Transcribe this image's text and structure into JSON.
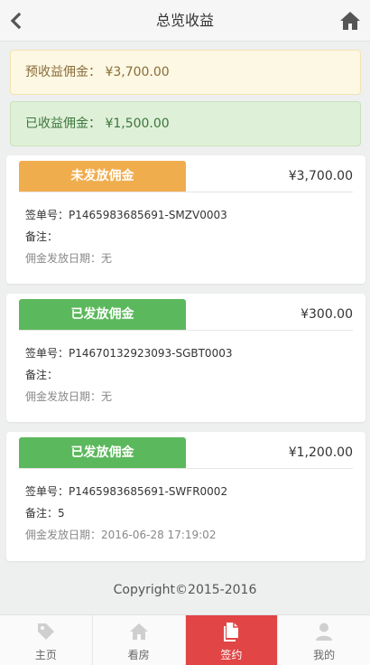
{
  "header": {
    "title": "总览收益"
  },
  "summary": {
    "pending": "预收益佣金： ¥3,700.00",
    "received": "已收益佣金： ¥1,500.00"
  },
  "cards": [
    {
      "status": "未发放佣金",
      "status_color": "#f0ad4e",
      "amount": "¥3,700.00",
      "order": "签单号：P1465983685691-SMZV0003",
      "note": "备注：",
      "date": "佣金发放日期：无"
    },
    {
      "status": "已发放佣金",
      "status_color": "#5cb85c",
      "amount": "¥300.00",
      "order": "签单号：P14670132923093-SGBT0003",
      "note": "备注：",
      "date": "佣金发放日期：无"
    },
    {
      "status": "已发放佣金",
      "status_color": "#5cb85c",
      "amount": "¥1,200.00",
      "order": "签单号：P1465983685691-SWFR0002",
      "note": "备注：5",
      "date": "佣金发放日期：2016-06-28 17:19:02"
    }
  ],
  "footer": {
    "copyright": "Copyright©2015-2016"
  },
  "tabs": [
    {
      "label": "主页",
      "icon": "tag-icon"
    },
    {
      "label": "看房",
      "icon": "home-icon"
    },
    {
      "label": "签约",
      "icon": "document-icon",
      "active": true
    },
    {
      "label": "我的",
      "icon": "user-icon"
    }
  ],
  "colors": {
    "active_tab": "#e14545",
    "orange": "#f0ad4e",
    "green": "#5cb85c"
  }
}
